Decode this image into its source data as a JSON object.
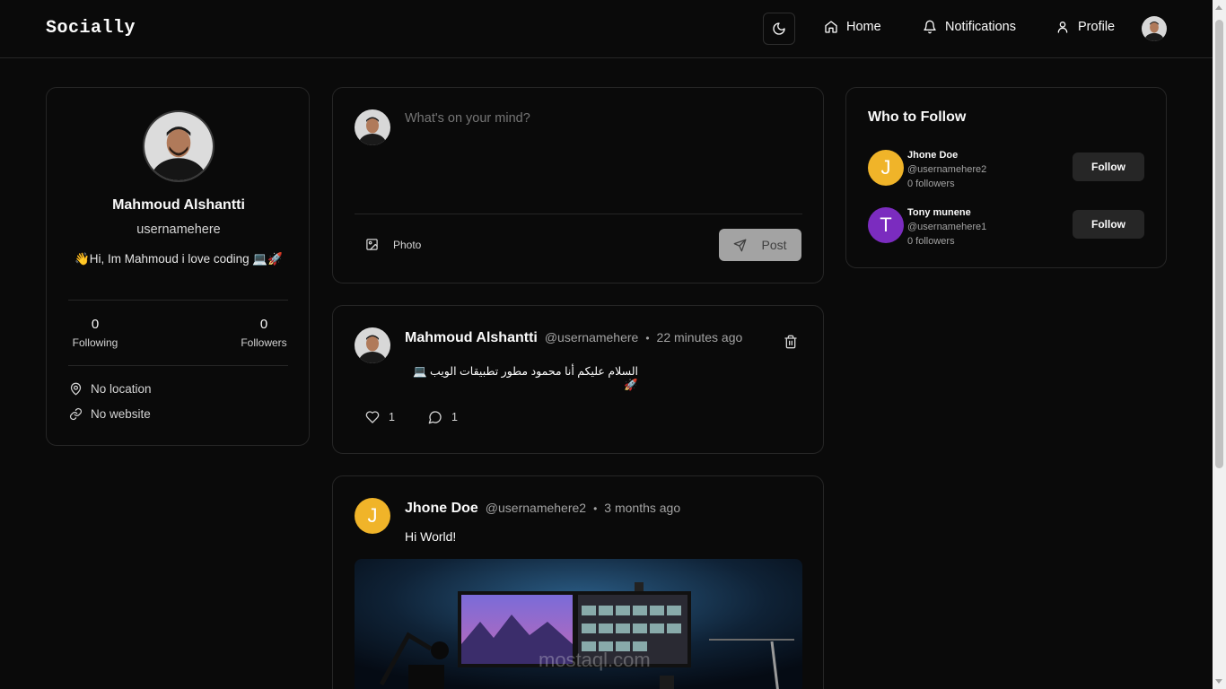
{
  "nav": {
    "brand": "Socially",
    "home": "Home",
    "notifications": "Notifications",
    "profile": "Profile"
  },
  "profile": {
    "name": "Mahmoud Alshantti",
    "username": "usernamehere",
    "bio": "👋Hi, Im Mahmoud i love coding 💻🚀",
    "following_count": "0",
    "following_label": "Following",
    "followers_count": "0",
    "followers_label": "Followers",
    "location": "No location",
    "website": "No website"
  },
  "composer": {
    "placeholder": "What's on your mind?",
    "photo_label": "Photo",
    "post_label": "Post"
  },
  "posts": [
    {
      "author": "Mahmoud Alshantti",
      "handle": "@usernamehere",
      "dot": "•",
      "time": "22 minutes ago",
      "content": "السلام عليكم أنا محمود مطور تطبيقات الويب 💻 🚀",
      "likes": "1",
      "comments": "1"
    },
    {
      "author": "Jhone Doe",
      "avatar_letter": "J",
      "handle": "@usernamehere2",
      "dot": "•",
      "time": "3 months ago",
      "content": "Hi World!",
      "image_watermark": "mostaql.com"
    }
  ],
  "who_to_follow": {
    "title": "Who to Follow",
    "users": [
      {
        "name": "Jhone Doe",
        "handle": "@usernamehere2",
        "followers": "0 followers",
        "letter": "J",
        "color": "#f0b429",
        "button": "Follow"
      },
      {
        "name": "Tony munene",
        "handle": "@usernamehere1",
        "followers": "0 followers",
        "letter": "T",
        "color": "#7b2cbf",
        "button": "Follow"
      }
    ]
  },
  "colors": {
    "background": "#0a0a0a",
    "border": "#262626",
    "post_button": "#a3a3a3"
  }
}
